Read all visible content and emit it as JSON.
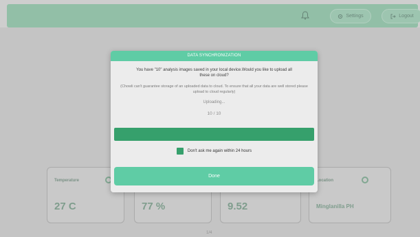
{
  "header": {
    "settings_label": "Settings",
    "logout_label": "Logout",
    "icons": {
      "bell": "bell-icon",
      "settings": "gear-icon",
      "logout": "logout-icon"
    }
  },
  "cards": [
    {
      "title": "Temperature",
      "value": "27 C"
    },
    {
      "title": "",
      "value": "77 %"
    },
    {
      "title": "",
      "value": "9.52"
    },
    {
      "title": "Location",
      "value": "Minglanilla PH"
    }
  ],
  "page_number": "1/4",
  "modal": {
    "title": "DATA SYNCHRONIZATION",
    "message": "You have \"10\" analysis images saved in your local device.Would you like to upload all these on cloud?",
    "note": "(Chowli can't guarantee storage of an uploaded data to cloud. To ensure that all your data are well stored please upload to cloud regularly)",
    "status": "Uploading...",
    "progress_text": "10 / 10",
    "progress": {
      "current": 10,
      "total": 10
    },
    "checkbox_label": "Don't ask me again within 24 hours",
    "checkbox_checked": true,
    "done_label": "Done"
  },
  "colors": {
    "accent": "#5fcca5",
    "progress": "#36a06c",
    "header_bar": "#9bcdb3"
  }
}
